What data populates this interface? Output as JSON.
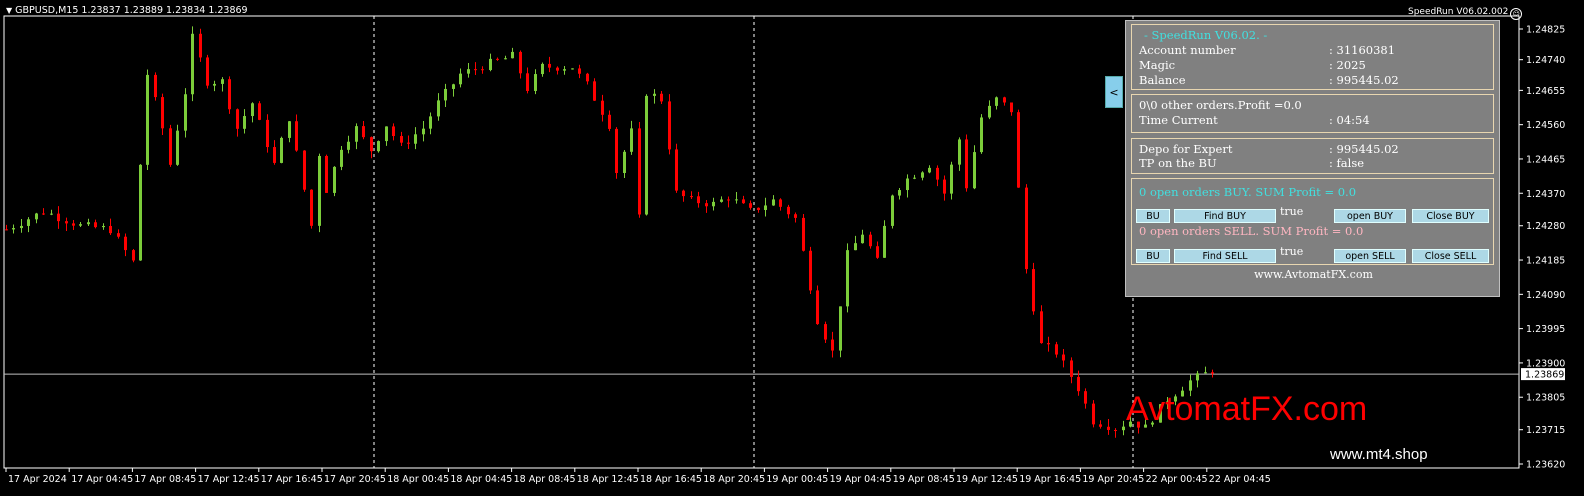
{
  "chart": {
    "symbol": "GBPUSD,M15",
    "ohlc": "1.23837 1.23889 1.23834 1.23869",
    "ea_name": "SpeedRun V06.02.002",
    "ea_face": "☺",
    "collapse_label": "<",
    "current_price": "1.23869",
    "colors": {
      "bull": "#7ccd3a",
      "bear": "#ff0000",
      "grid": "#ffffff",
      "bg": "#000000"
    }
  },
  "chart_data": {
    "type": "candlestick",
    "symbol": "GBPUSD",
    "timeframe": "M15",
    "price_ticks": [
      "1.24825",
      "1.24740",
      "1.24655",
      "1.24560",
      "1.24465",
      "1.24370",
      "1.24280",
      "1.24185",
      "1.24090",
      "1.23995",
      "1.23900",
      "1.23805",
      "1.23715",
      "1.23620"
    ],
    "time_ticks": [
      "17 Apr 2024",
      "17 Apr 04:45",
      "17 Apr 08:45",
      "17 Apr 12:45",
      "17 Apr 16:45",
      "17 Apr 20:45",
      "18 Apr 00:45",
      "18 Apr 04:45",
      "18 Apr 08:45",
      "18 Apr 12:45",
      "18 Apr 16:45",
      "18 Apr 20:45",
      "19 Apr 00:45",
      "19 Apr 04:45",
      "19 Apr 08:45",
      "19 Apr 12:45",
      "19 Apr 16:45",
      "19 Apr 20:45",
      "22 Apr 00:45",
      "22 Apr 04:45"
    ],
    "ylim": [
      1.236,
      1.2488
    ],
    "current_price": 1.23869,
    "close_path": [
      [
        0,
        1.2427
      ],
      [
        5,
        1.2432
      ],
      [
        10,
        1.2428
      ],
      [
        14,
        1.2427
      ],
      [
        17,
        1.2418
      ],
      [
        18,
        1.2445
      ],
      [
        19,
        1.247
      ],
      [
        21,
        1.2455
      ],
      [
        22,
        1.2445
      ],
      [
        24,
        1.2465
      ],
      [
        25,
        1.248
      ],
      [
        27,
        1.2468
      ],
      [
        29,
        1.2468
      ],
      [
        31,
        1.2455
      ],
      [
        33,
        1.2462
      ],
      [
        36,
        1.2445
      ],
      [
        38,
        1.2458
      ],
      [
        41,
        1.2428
      ],
      [
        42,
        1.2448
      ],
      [
        43,
        1.2438
      ],
      [
        45,
        1.245
      ],
      [
        47,
        1.2455
      ],
      [
        49,
        1.2449
      ],
      [
        51,
        1.2456
      ],
      [
        53,
        1.245
      ],
      [
        56,
        1.2455
      ],
      [
        58,
        1.2462
      ],
      [
        61,
        1.247
      ],
      [
        65,
        1.2473
      ],
      [
        68,
        1.2475
      ],
      [
        70,
        1.2466
      ],
      [
        72,
        1.2472
      ],
      [
        76,
        1.2472
      ],
      [
        78,
        1.2467
      ],
      [
        81,
        1.2456
      ],
      [
        82,
        1.2443
      ],
      [
        84,
        1.2454
      ],
      [
        85,
        1.243
      ],
      [
        86,
        1.2465
      ],
      [
        88,
        1.2463
      ],
      [
        90,
        1.2437
      ],
      [
        92,
        1.2435
      ],
      [
        95,
        1.2434
      ],
      [
        97,
        1.2436
      ],
      [
        100,
        1.2432
      ],
      [
        103,
        1.2435
      ],
      [
        106,
        1.243
      ],
      [
        109,
        1.2402
      ],
      [
        111,
        1.2393
      ],
      [
        113,
        1.242
      ],
      [
        115,
        1.2426
      ],
      [
        117,
        1.2418
      ],
      [
        119,
        1.2437
      ],
      [
        121,
        1.2441
      ],
      [
        124,
        1.2445
      ],
      [
        126,
        1.2437
      ],
      [
        128,
        1.2452
      ],
      [
        129,
        1.2439
      ],
      [
        131,
        1.2458
      ],
      [
        133,
        1.2463
      ],
      [
        135,
        1.246
      ],
      [
        137,
        1.2416
      ],
      [
        139,
        1.2395
      ],
      [
        141,
        1.2393
      ],
      [
        144,
        1.2383
      ],
      [
        146,
        1.2374
      ],
      [
        149,
        1.2372
      ],
      [
        151,
        1.2374
      ],
      [
        153,
        1.2372
      ],
      [
        156,
        1.238
      ],
      [
        159,
        1.2385
      ],
      [
        162,
        1.2388
      ]
    ]
  },
  "panel": {
    "title": "- SpeedRun V06.02. -",
    "account_label": "Account number",
    "account_value": ": 31160381",
    "magic_label": "Magic",
    "magic_value": ": 2025",
    "balance_label": "Balance",
    "balance_value": ": 995445.02",
    "other_orders": "0\\0 other orders.Profit =0.0",
    "time_label": "Time Current",
    "time_value": ": 04:54",
    "depo_label": "Depo for Expert",
    "depo_value": ": 995445.02",
    "tp_label": "TP on the BU",
    "tp_value": ": false",
    "buy_summary": "0 open orders BUY. SUM Profit = 0.0",
    "sell_summary": "0 open orders SELL. SUM Profit = 0.0",
    "bu_buy": "BU",
    "find_buy": "Find BUY",
    "find_buy_state": "true",
    "open_buy": "open BUY",
    "close_buy": "Close BUY",
    "bu_sell": "BU",
    "find_sell": "Find SELL",
    "find_sell_state": "true",
    "open_sell": "open SELL",
    "close_sell": "Close SELL",
    "website": "www.AvtomatFX.com"
  },
  "watermark": {
    "brand": "AvtomatFX.com",
    "shop": "www.mt4.shop"
  }
}
